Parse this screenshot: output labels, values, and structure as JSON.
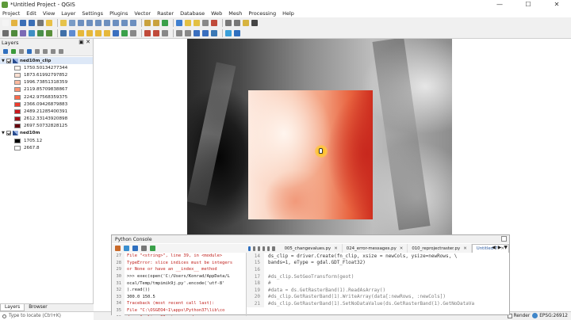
{
  "window": {
    "title": "*Untitled Project - QGIS",
    "controls": [
      "—",
      "☐",
      "✕"
    ]
  },
  "menu": [
    "Project",
    "Edit",
    "View",
    "Layer",
    "Settings",
    "Plugins",
    "Vector",
    "Raster",
    "Database",
    "Web",
    "Mesh",
    "Processing",
    "Help"
  ],
  "toolbar_icons": {
    "row1": [
      "new-icon",
      "open-icon",
      "save-icon",
      "save-as-icon",
      "print-icon",
      "layout-icon",
      "pan-icon",
      "pan-selection-icon",
      "zoom-in-icon",
      "zoom-out-icon",
      "zoom-full-icon",
      "zoom-selection-icon",
      "zoom-layer-icon",
      "zoom-last-icon",
      "zoom-next-icon",
      "new-bookmark-icon",
      "show-bookmarks-icon",
      "refresh-icon",
      "identify-icon",
      "select-icon",
      "deselect-icon",
      "attribute-table-icon",
      "field-calc-icon",
      "statistics-icon",
      "measure-icon",
      "annotation-icon",
      "label-icon"
    ],
    "row2": [
      "data-source-icon",
      "add-vector-icon",
      "add-raster-icon",
      "add-mesh-icon",
      "add-csv-icon",
      "add-spatialite-icon",
      "add-postgis-icon",
      "add-wms-icon",
      "new-layer-icon",
      "new-temp-layer-icon",
      "digitize-icon",
      "edit-icon",
      "save-edits-icon",
      "add-feature-icon",
      "move-feature-icon",
      "node-tool-icon",
      "delete-icon",
      "cut-icon",
      "copy-icon",
      "paste-icon",
      "undo-icon",
      "redo-icon",
      "python-icon",
      "plugin-icon",
      "help-icon"
    ]
  },
  "colors": {
    "row1": [
      "#f4f4f4",
      "#e3b341",
      "#3b6fb6",
      "#3b6fb6",
      "#777777",
      "#e8c046",
      "#e6c34a",
      "#7a9cc6",
      "#6c8fbf",
      "#6c8fbf",
      "#6c8fbf",
      "#6c8fbf",
      "#6c8fbf",
      "#6c8fbf",
      "#6c8fbf",
      "#c9a23e",
      "#c9a23e",
      "#3aa04a",
      "#3f7fcf",
      "#e3c041",
      "#e3c041",
      "#888888",
      "#c04a3a",
      "#777777",
      "#777777",
      "#d7b440",
      "#444444"
    ],
    "row2": [
      "#6e6e6e",
      "#4f8a3c",
      "#7b6bb5",
      "#3f8fc4",
      "#4a8f4a",
      "#5a8f3a",
      "#3f6fa8",
      "#5e8bd2",
      "#e6b83a",
      "#e6b83a",
      "#e6b83a",
      "#e6b83a",
      "#3a6fbf",
      "#3aa04a",
      "#888888",
      "#c04a3a",
      "#c04a3a",
      "#888888",
      "#888888",
      "#888888",
      "#3a6fbf",
      "#3a6fbf",
      "#3b78b5",
      "#3a9fd8",
      "#2f6fbf"
    ]
  },
  "layers_panel": {
    "title": "Layers",
    "ctl": "▣ ✕",
    "layers": [
      {
        "name": "ned10m_clip",
        "selected": true,
        "entries": [
          {
            "label": "1750.50134277344",
            "color": "#fff5f0"
          },
          {
            "label": "1873.61992797852",
            "color": "#fee0d2"
          },
          {
            "label": "1996.73851318359",
            "color": "#fcbba1"
          },
          {
            "label": "2119.85709838867",
            "color": "#fc9272"
          },
          {
            "label": "2242.97568359375",
            "color": "#fb6a4a"
          },
          {
            "label": "2366.09426879883",
            "color": "#ef3b2c"
          },
          {
            "label": "2489.21285400391",
            "color": "#cb181d"
          },
          {
            "label": "2612.33143920898",
            "color": "#a50f15"
          },
          {
            "label": "2697.50732828125",
            "color": "#67000d"
          }
        ]
      },
      {
        "name": "ned10m",
        "selected": false,
        "entries": [
          {
            "label": "1705.12",
            "color": "#000000"
          },
          {
            "label": "2667.8",
            "color": "#ffffff"
          }
        ]
      }
    ]
  },
  "bottom_tabs": [
    "Layers",
    "Browser"
  ],
  "search": {
    "placeholder": "Type to locate (Ctrl+K)"
  },
  "status": {
    "render": "Render",
    "crs": "EPSG:26912"
  },
  "console": {
    "title": "Python Console",
    "tool_colors": [
      "#c96a2b",
      "#3a8fd0",
      "#2f6fbf",
      "#777777",
      "#3aa04a"
    ],
    "shell": [
      {
        "n": "27",
        "text": "  File \"<string>\", line 39, in <module>",
        "cls": "red"
      },
      {
        "n": "28",
        "text": "TypeError: slice indices must be integers",
        "cls": "red"
      },
      {
        "n": "29",
        "text": "  or None or have an __index__ method",
        "cls": "red"
      },
      {
        "n": "30",
        "text": ">>> exec(open('C:/Users/Konrad/AppData/L",
        "cls": "blk"
      },
      {
        "n": "31",
        "text": "ocal/Temp/tmpimik9j.py'.encode('utf-8'",
        "cls": "blk"
      },
      {
        "n": "32",
        "text": ").read())",
        "cls": "blk"
      },
      {
        "n": "33",
        "text": "300.0 150.5",
        "cls": "blk"
      },
      {
        "n": "34",
        "text": "Traceback (most recent call last):",
        "cls": "red"
      },
      {
        "n": "35",
        "text": "  File \"C:\\OSGEO4~1\\apps\\Python37\\lib\\co",
        "cls": "red"
      },
      {
        "n": "36",
        "text": "de.py\", line 90, in runcode",
        "cls": "red"
      },
      {
        "n": "37",
        "text": "    exec(code, self.locals)",
        "cls": "red"
      }
    ],
    "editor_tabs": [
      {
        "label": "005_changevalues.py",
        "active": false
      },
      {
        "label": "024_error-messages.py",
        "active": false
      },
      {
        "label": "010_reprojectraster.py",
        "active": false
      },
      {
        "label": "Untitled-7",
        "active": true
      }
    ],
    "editor": [
      {
        "n": "14",
        "text": "ds_clip = driver.Create(fn_clip, xsize = newCols, ysize=newRows, \\",
        "cm": false
      },
      {
        "n": "15",
        "text": "bands=1, eType = gdal.GDT_Float32)",
        "cm": false
      },
      {
        "n": "16",
        "text": "",
        "cm": false
      },
      {
        "n": "17",
        "text": "#ds_clip.SetGeoTransform(geot)",
        "cm": true
      },
      {
        "n": "18",
        "text": "#",
        "cm": true
      },
      {
        "n": "19",
        "text": "#data = ds.GetRasterBand(1).ReadAsArray()",
        "cm": true
      },
      {
        "n": "20",
        "text": "#ds_clip.GetRasterBand(1).WriteArray(data[:newRows, :newCols])",
        "cm": true
      },
      {
        "n": "21",
        "text": "#ds_clip.GetRasterBand(1).SetNoDataValue(ds.GetRasterBand(1).GetNoDataVa",
        "cm": true
      }
    ]
  }
}
